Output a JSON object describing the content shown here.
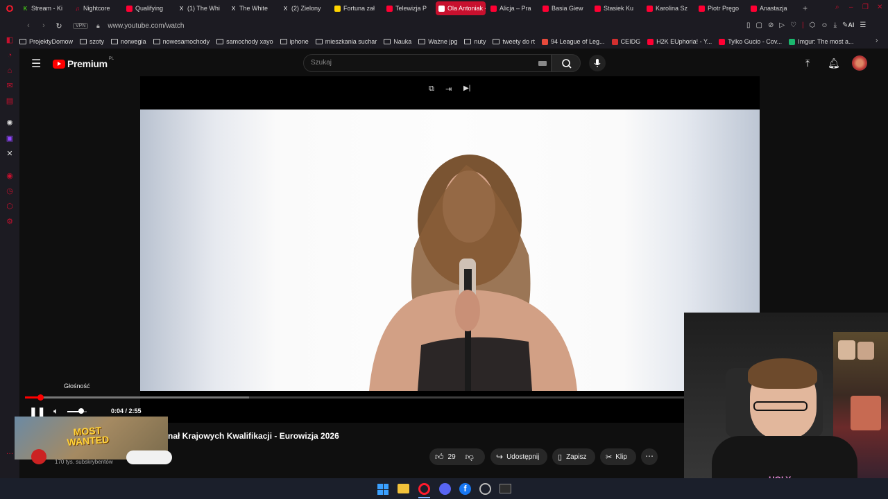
{
  "browser": {
    "tabs": [
      {
        "label": "Stream - Ki",
        "color": "#53fc18",
        "glyph": "K"
      },
      {
        "label": "Nightcore",
        "color": "#ff0033",
        "glyph": "♫"
      },
      {
        "label": "Qualifying",
        "color": "#ff0033",
        "glyph": ""
      },
      {
        "label": "(1) The Whi",
        "color": "#000000",
        "glyph": "X"
      },
      {
        "label": "The White",
        "color": "#000000",
        "glyph": "X"
      },
      {
        "label": "(2) Zielony",
        "color": "#000000",
        "glyph": "X"
      },
      {
        "label": "Fortuna zał",
        "color": "#ffd400",
        "glyph": ""
      },
      {
        "label": "Telewizja P",
        "color": "#ff0033",
        "glyph": ""
      },
      {
        "label": "Ola Antoniak - Do",
        "color": "#ffffff",
        "glyph": ""
      },
      {
        "label": "Alicja – Pra",
        "color": "#ff0033",
        "glyph": ""
      },
      {
        "label": "Basia Giew",
        "color": "#ff0033",
        "glyph": ""
      },
      {
        "label": "Stasiek Ku",
        "color": "#ff0033",
        "glyph": ""
      },
      {
        "label": "Karolina Sz",
        "color": "#ff0033",
        "glyph": ""
      },
      {
        "label": "Piotr Pręgo",
        "color": "#ff0033",
        "glyph": ""
      },
      {
        "label": "Anastazja",
        "color": "#ff0033",
        "glyph": ""
      }
    ],
    "active_tab_index": 8,
    "new_tab": "+",
    "vpn_label": "VPN",
    "url": "www.youtube.com/watch",
    "ai_label": "AI",
    "bookmarks": [
      {
        "label": "ProjektyDomow",
        "type": "folder"
      },
      {
        "label": "szoty",
        "type": "folder"
      },
      {
        "label": "norwegia",
        "type": "folder"
      },
      {
        "label": "nowesamochody",
        "type": "folder"
      },
      {
        "label": "samochody xayo",
        "type": "folder"
      },
      {
        "label": "iphone",
        "type": "folder"
      },
      {
        "label": "mieszkania suchar",
        "type": "folder"
      },
      {
        "label": "Nauka",
        "type": "folder"
      },
      {
        "label": "Ważne jpg",
        "type": "folder"
      },
      {
        "label": "nuty",
        "type": "folder"
      },
      {
        "label": "tweety do rt",
        "type": "folder"
      },
      {
        "label": "94 League of Leg...",
        "type": "site",
        "color": "#e84a3c"
      },
      {
        "label": "CEIDG",
        "type": "site",
        "color": "#d32f2f"
      },
      {
        "label": "H2K EUphoria! - Y...",
        "type": "site",
        "color": "#ff0033"
      },
      {
        "label": "Tylko Gucio - Cov...",
        "type": "site",
        "color": "#ff0033"
      },
      {
        "label": "Imgur: The most a...",
        "type": "site",
        "color": "#1bb76e"
      }
    ]
  },
  "youtube": {
    "brand": "Premium",
    "region": "PL",
    "search_placeholder": "Szukaj",
    "volume_tooltip": "Głośność",
    "time_display": "0:04 / 2:55",
    "progress_fraction": 0.023,
    "buffered_fraction": 0.34,
    "volume_fraction": 0.7,
    "video_title": "nał Krajowych Kwalifikacji - Eurowizja 2026",
    "channel_subs": "170 tys. subskrybentów",
    "likes": "29",
    "share_label": "Udostępnij",
    "save_label": "Zapisz",
    "clip_label": "Klip",
    "ad_text_1": "MOST",
    "ad_text_2": "WANTED"
  },
  "webcam": {
    "shirt_text": "HOLY"
  }
}
